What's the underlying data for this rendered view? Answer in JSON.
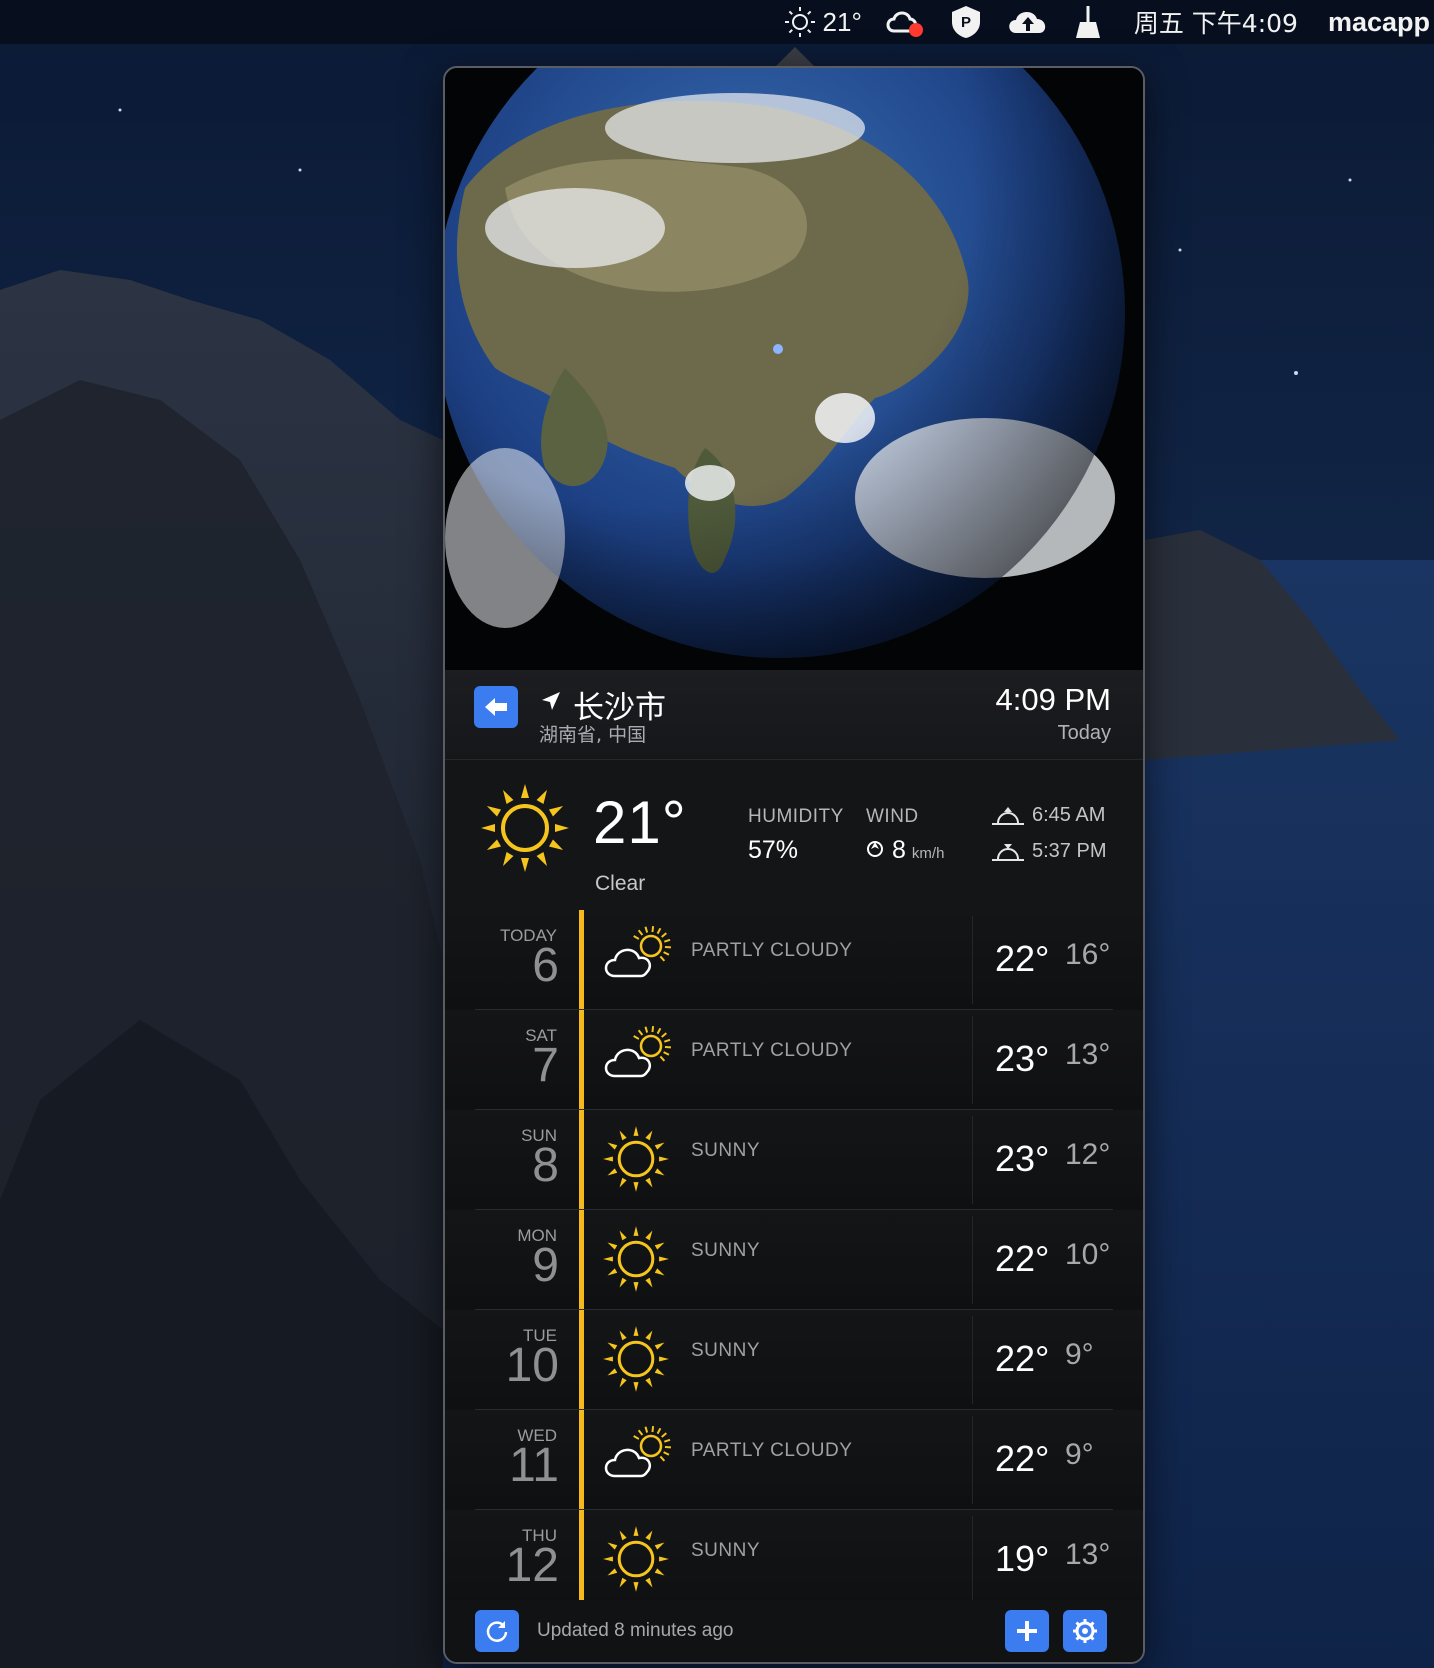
{
  "menubar": {
    "weather_temp": "21°",
    "clock": "周五 下午4:09",
    "app_name": "macapp",
    "icons": [
      "sun-icon",
      "creative-cloud-icon",
      "paw-shield-icon",
      "cloud-upload-icon",
      "broom-icon"
    ]
  },
  "location": {
    "city": "长沙市",
    "region": "湖南省, 中国",
    "time": "4:09 PM",
    "day": "Today"
  },
  "current": {
    "temperature": "21°",
    "condition": "Clear",
    "humidity_label": "HUMIDITY",
    "humidity_value": "57%",
    "wind_label": "WIND",
    "wind_value": "8",
    "wind_unit": "km/h",
    "sunrise": "6:45 AM",
    "sunset": "5:37 PM"
  },
  "forecast": [
    {
      "day": "TODAY",
      "date": "6",
      "icon": "partly-cloudy",
      "condition": "PARTLY CLOUDY",
      "high": "22°",
      "low": "16°"
    },
    {
      "day": "SAT",
      "date": "7",
      "icon": "partly-cloudy",
      "condition": "PARTLY CLOUDY",
      "high": "23°",
      "low": "13°"
    },
    {
      "day": "SUN",
      "date": "8",
      "icon": "sunny",
      "condition": "SUNNY",
      "high": "23°",
      "low": "12°"
    },
    {
      "day": "MON",
      "date": "9",
      "icon": "sunny",
      "condition": "SUNNY",
      "high": "22°",
      "low": "10°"
    },
    {
      "day": "TUE",
      "date": "10",
      "icon": "sunny",
      "condition": "SUNNY",
      "high": "22°",
      "low": "9°"
    },
    {
      "day": "WED",
      "date": "11",
      "icon": "partly-cloudy",
      "condition": "PARTLY CLOUDY",
      "high": "22°",
      "low": "9°"
    },
    {
      "day": "THU",
      "date": "12",
      "icon": "sunny",
      "condition": "SUNNY",
      "high": "19°",
      "low": "13°"
    }
  ],
  "footer": {
    "updated": "Updated 8 minutes ago"
  },
  "colors": {
    "accent": "#3b7cf0",
    "sun": "#f6c51d",
    "bar": "#f6b91d"
  }
}
